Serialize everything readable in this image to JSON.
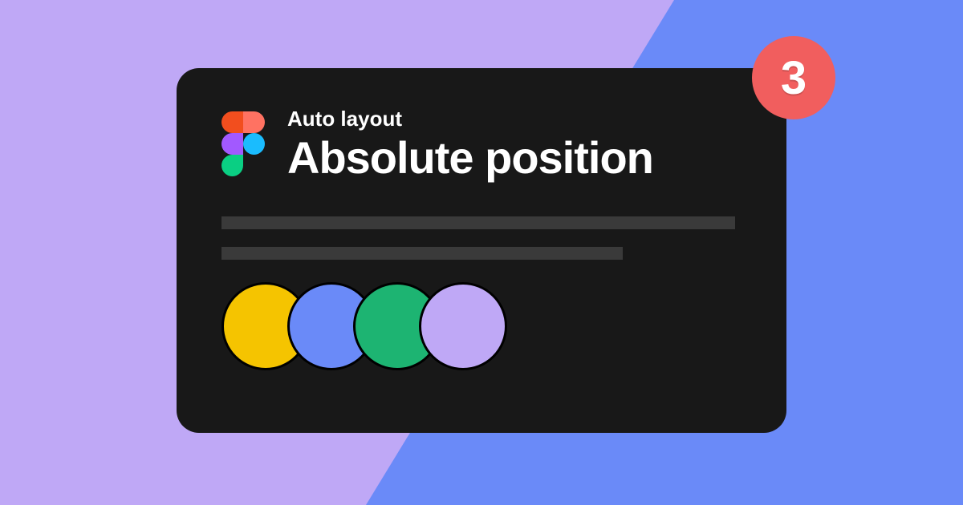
{
  "card": {
    "subtitle": "Auto layout",
    "title": "Absolute position"
  },
  "badge": {
    "number": "3",
    "color": "#f15e5e"
  },
  "dots": [
    {
      "color": "#f5c400"
    },
    {
      "color": "#6a8af8"
    },
    {
      "color": "#1db472"
    },
    {
      "color": "#bfa8f6"
    }
  ],
  "background": {
    "left": "#bfa8f6",
    "right": "#6a8af8"
  }
}
